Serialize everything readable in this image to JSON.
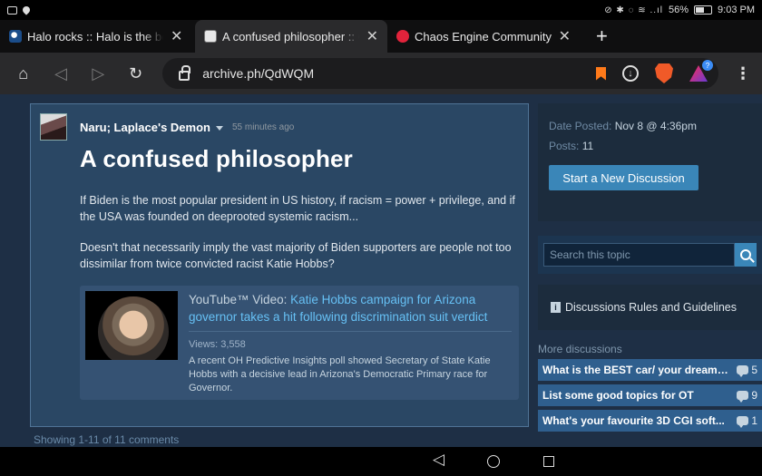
{
  "status_bar": {
    "battery": "56%",
    "time": "9:03 PM"
  },
  "tabs": [
    {
      "title": "Halo rocks :: Halo is the best g",
      "favicon": "steam-icon",
      "active": false
    },
    {
      "title": "A confused philosopher :: Off T",
      "favicon": "archive-icon",
      "active": true
    },
    {
      "title": "Chaos Engine Community",
      "favicon": "chaos-icon",
      "active": false
    }
  ],
  "toolbar": {
    "url": "archive.ph/QdWQM"
  },
  "post": {
    "author": "Naru; Laplace's Demon",
    "time_ago": "55 minutes ago",
    "title": "A confused philosopher",
    "body_p1": "If Biden is the most popular president in US history, if racism = power + privilege, and if the USA was founded on deeprooted systemic racism...",
    "body_p2": "Doesn't that necessarily imply the vast majority of Biden supporters are people not too dissimilar from twice convicted racist Katie Hobbs?",
    "video": {
      "prefix": "YouTube™ Video: ",
      "title": "Katie Hobbs campaign for Arizona governor takes a hit following discrimination suit verdict",
      "views": "Views: 3,558",
      "description": "A recent OH Predictive Insights poll showed Secretary of State Katie Hobbs with a decisive lead in Arizona's Democratic Primary race for Governor."
    }
  },
  "showing": "Showing 1-11 of 11 comments",
  "sidebar": {
    "date_label": "Date Posted:",
    "date_value": "Nov 8 @ 4:36pm",
    "posts_label": "Posts:",
    "posts_value": "11",
    "new_discussion": "Start a New Discussion",
    "search_placeholder": "Search this topic",
    "rules": "Discussions Rules and Guidelines",
    "more_title": "More discussions",
    "discussions": [
      {
        "name": "What is the BEST car/ your dream ...",
        "count": "5"
      },
      {
        "name": "List some good topics for OT",
        "count": "9"
      },
      {
        "name": "What's your favourite 3D CGI soft...",
        "count": "1"
      }
    ]
  }
}
